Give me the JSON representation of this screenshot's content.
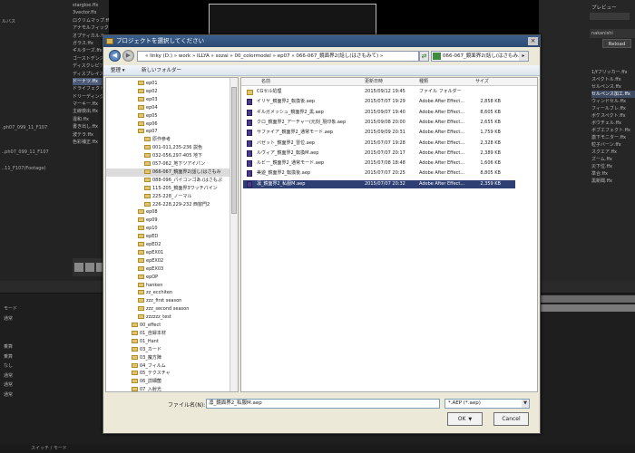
{
  "background": {
    "left_list": [
      "stargloe.ffx",
      "3vector.ffx",
      "ロクリムマップ.ffx",
      "アナモルフィック.ffx",
      "オプティカル.ffx",
      "ガラス.ffx",
      "ギルターズ.ffx",
      "ゴーストデンスレ",
      "ディスクレピア",
      "ディスプレイス.ffx",
      "ドーナツ.ffx",
      "ドライフェクト",
      "ドリーディング",
      "マーキー.ffx",
      "主線検出.ffx",
      "違和.ffx",
      "書き出し.ffx",
      "波テラ.ffx",
      "色彩補正.ffx"
    ],
    "left_side": [
      "ルバス",
      "",
      "",
      "",
      "",
      "",
      "",
      "",
      "",
      "",
      "",
      "",
      "",
      ".ph07_099_11_F107",
      "",
      "",
      "..ph07_099_11_F107",
      "",
      "..11_F107(Footage)"
    ],
    "right_title": "プレビュー",
    "right_tab": "nakanishi",
    "reload_label": "Reload",
    "right_list": [
      "1/fフリッカー.ffx",
      "スペクトル.ffx",
      "セルペンス.ffx",
      "セルペンス加工.ffx",
      "ウィンドセル.ffx",
      "フィールブレ.ffx",
      "ボケスペクト.ffx",
      "ボウチェル.ffx",
      "ボブエフェクト.ffx",
      "激下モニター.ffx",
      "粒子バーン.ffx",
      "スクエア.ffx",
      "ズーム.ffx",
      "災下位.ffx",
      "準合.ffx",
      "黒新聞.ffx"
    ],
    "timeline_rows": [
      "モード",
      "通常",
      "",
      "",
      "乗算",
      "乗算",
      "なし",
      "通常",
      "通常",
      "通常"
    ],
    "status_text": "スイッチ / モード"
  },
  "dialog": {
    "title": "プロジェクトを選択してください",
    "close_label": "×",
    "breadcrumb": "«  linky (D:)  »  work  »  ILLYA  »  sozai  »  00_colormodel  »  ep07  »  066-067_鏡面界2(話し(はさもみて)  »",
    "search_value": "066-067_鏡面界2(話し(はさもみ...",
    "organize_label": "整理  ▾",
    "new_folder_label": "新しいフォルダー",
    "tree": [
      {
        "label": "ep01",
        "indent": 1
      },
      {
        "label": "ep02",
        "indent": 1
      },
      {
        "label": "ep03",
        "indent": 1
      },
      {
        "label": "ep04",
        "indent": 1
      },
      {
        "label": "ep05",
        "indent": 1
      },
      {
        "label": "ep06",
        "indent": 1
      },
      {
        "label": "ep07",
        "indent": 1
      },
      {
        "label": "原作参考",
        "indent": 2
      },
      {
        "label": "001-011,235-236 説色",
        "indent": 2
      },
      {
        "label": "032-056,297-405 地下",
        "indent": 2
      },
      {
        "label": "057-062_地下ツアイパン",
        "indent": 2
      },
      {
        "label": "066-067_鏡面界2(話し(はさもみ",
        "indent": 2,
        "selected": true
      },
      {
        "label": "088-096_パイコンゴあ.(はさもぷ",
        "indent": 2
      },
      {
        "label": "115-205_鏡面界3ワッチパイン",
        "indent": 2
      },
      {
        "label": "225-228_ノーマル",
        "indent": 2
      },
      {
        "label": "226-228,229-232 西窗門2",
        "indent": 2
      },
      {
        "label": "ep08",
        "indent": 1
      },
      {
        "label": "ep09",
        "indent": 1
      },
      {
        "label": "ep10",
        "indent": 1
      },
      {
        "label": "epED",
        "indent": 1
      },
      {
        "label": "epED2",
        "indent": 1
      },
      {
        "label": "epEX01",
        "indent": 1
      },
      {
        "label": "epEX02",
        "indent": 1
      },
      {
        "label": "epEX03",
        "indent": 1
      },
      {
        "label": "epOP",
        "indent": 1
      },
      {
        "label": "hanken",
        "indent": 1
      },
      {
        "label": "zz_ecchiten",
        "indent": 1
      },
      {
        "label": "zzz_first season",
        "indent": 1
      },
      {
        "label": "zzz_second season",
        "indent": 1
      },
      {
        "label": "zzzzzz_test",
        "indent": 1
      },
      {
        "label": "00_effect",
        "indent": 0
      },
      {
        "label": "01_自録本材",
        "indent": 0
      },
      {
        "label": "01_Hant",
        "indent": 0
      },
      {
        "label": "03_カード",
        "indent": 0
      },
      {
        "label": "03_魔方陣",
        "indent": 0
      },
      {
        "label": "04_フィルム",
        "indent": 0
      },
      {
        "label": "05_テクスチャ",
        "indent": 0
      },
      {
        "label": "06_詳細菌",
        "indent": 0
      },
      {
        "label": "07_入射光",
        "indent": 0
      }
    ],
    "columns": {
      "name": "名前",
      "date": "更新日時",
      "type": "種類",
      "size": "サイズ"
    },
    "files": [
      {
        "name": "CGセル処理",
        "date": "2015/09/12 19:45",
        "type": "ファイル フォルダー",
        "size": "",
        "folder": true
      },
      {
        "name": "イリヤ_鏡面界2_転換後.aep",
        "date": "2015/07/07 19:29",
        "type": "Adobe After Effect...",
        "size": "2,858 KB"
      },
      {
        "name": "ギルガメッシュ_鏡面界2_黒.aep",
        "date": "2015/09/07 19:40",
        "type": "Adobe After Effect...",
        "size": "8,605 KB"
      },
      {
        "name": "クロ_鏡面界2_アーチャー(元刻_現印象.aep",
        "date": "2015/09/08 20:00",
        "type": "Adobe After Effect...",
        "size": "2,655 KB"
      },
      {
        "name": "サファイア_鏡面界2_通常モード.aep",
        "date": "2015/09/09 20:31",
        "type": "Adobe After Effect...",
        "size": "1,759 KB"
      },
      {
        "name": "バゼット_鏡面界2_冒位.aep",
        "date": "2015/07/07 19:28",
        "type": "Adobe After Effect...",
        "size": "2,328 KB"
      },
      {
        "name": "ルヴィア_鏡面界2_転換M.aep",
        "date": "2015/07/07 20:17",
        "type": "Adobe After Effect...",
        "size": "2,389 KB"
      },
      {
        "name": "ルビー_鏡面界2_通常モード.aep",
        "date": "2015/07/08 18:48",
        "type": "Adobe After Effect...",
        "size": "1,606 KB"
      },
      {
        "name": "美遊_鏡面界2_転換後.aep",
        "date": "2015/07/07 20:25",
        "type": "Adobe After Effect...",
        "size": "8,805 KB"
      },
      {
        "name": "凛_鏡面界2_私服M.aep",
        "date": "2015/07/07 20:32",
        "type": "Adobe After Effect...",
        "size": "2,359 KB",
        "selected": true
      }
    ],
    "filename_label": "ファイル名(N):",
    "filename_value": "凛_鏡面界2_私服M.aep",
    "filetype_value": "*.AEP (*.aep)",
    "ok_label": "OK",
    "cancel_label": "Cancel"
  }
}
